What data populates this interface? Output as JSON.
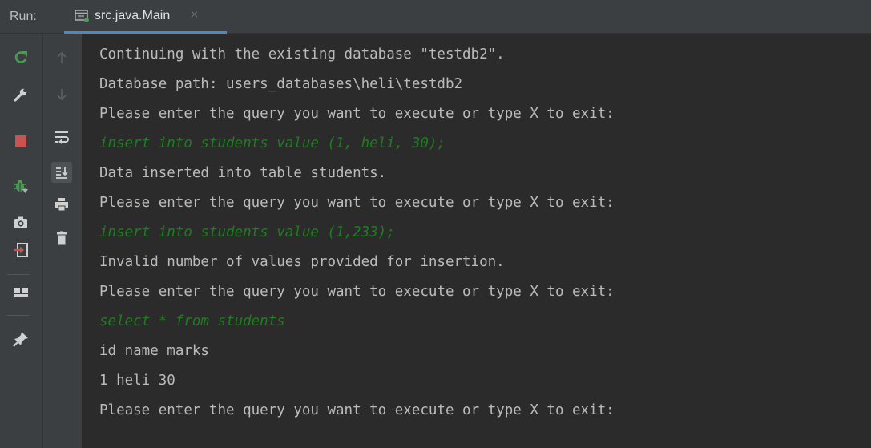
{
  "header": {
    "run_label": "Run:",
    "tab_title": "src.java.Main",
    "tab_close": "×"
  },
  "colors": {
    "panel_bg": "#3c3f41",
    "console_bg": "#2b2b2b",
    "console_text": "#bbbbbb",
    "input_text": "#1e7d1e",
    "tab_underline": "#4a88c7",
    "stop_red": "#c75450",
    "rerun_green": "#499c54"
  },
  "toolbar_primary": [
    {
      "icon": "rerun-icon"
    },
    {
      "icon": "wrench-icon"
    },
    {
      "icon": "stop-icon"
    },
    {
      "icon": "bug-icon"
    },
    {
      "icon": "camera-icon"
    },
    {
      "icon": "exit-icon"
    },
    {
      "icon": "layout-icon"
    },
    {
      "icon": "pin-icon"
    }
  ],
  "toolbar_secondary": [
    {
      "icon": "arrow-up-icon"
    },
    {
      "icon": "arrow-down-icon"
    },
    {
      "icon": "soft-wrap-icon"
    },
    {
      "icon": "scroll-to-end-icon"
    },
    {
      "icon": "print-icon"
    },
    {
      "icon": "trash-icon"
    }
  ],
  "console": {
    "lines": [
      {
        "text": "Continuing with the existing database \"testdb2\".",
        "kind": "output"
      },
      {
        "text": "Database path: users_databases\\heli\\testdb2",
        "kind": "output"
      },
      {
        "text": "Please enter the query you want to execute or type X to exit:",
        "kind": "output"
      },
      {
        "text": "insert into students value (1, heli, 30);",
        "kind": "input"
      },
      {
        "text": "Data inserted into table students.",
        "kind": "output"
      },
      {
        "text": "Please enter the query you want to execute or type X to exit:",
        "kind": "output"
      },
      {
        "text": "insert into students value (1,233);",
        "kind": "input"
      },
      {
        "text": "Invalid number of values provided for insertion.",
        "kind": "output"
      },
      {
        "text": "Please enter the query you want to execute or type X to exit:",
        "kind": "output"
      },
      {
        "text": "select * from students",
        "kind": "input"
      },
      {
        "text": "id name marks",
        "kind": "output"
      },
      {
        "text": "1 heli 30",
        "kind": "output"
      },
      {
        "text": "Please enter the query you want to execute or type X to exit:",
        "kind": "output"
      }
    ]
  }
}
